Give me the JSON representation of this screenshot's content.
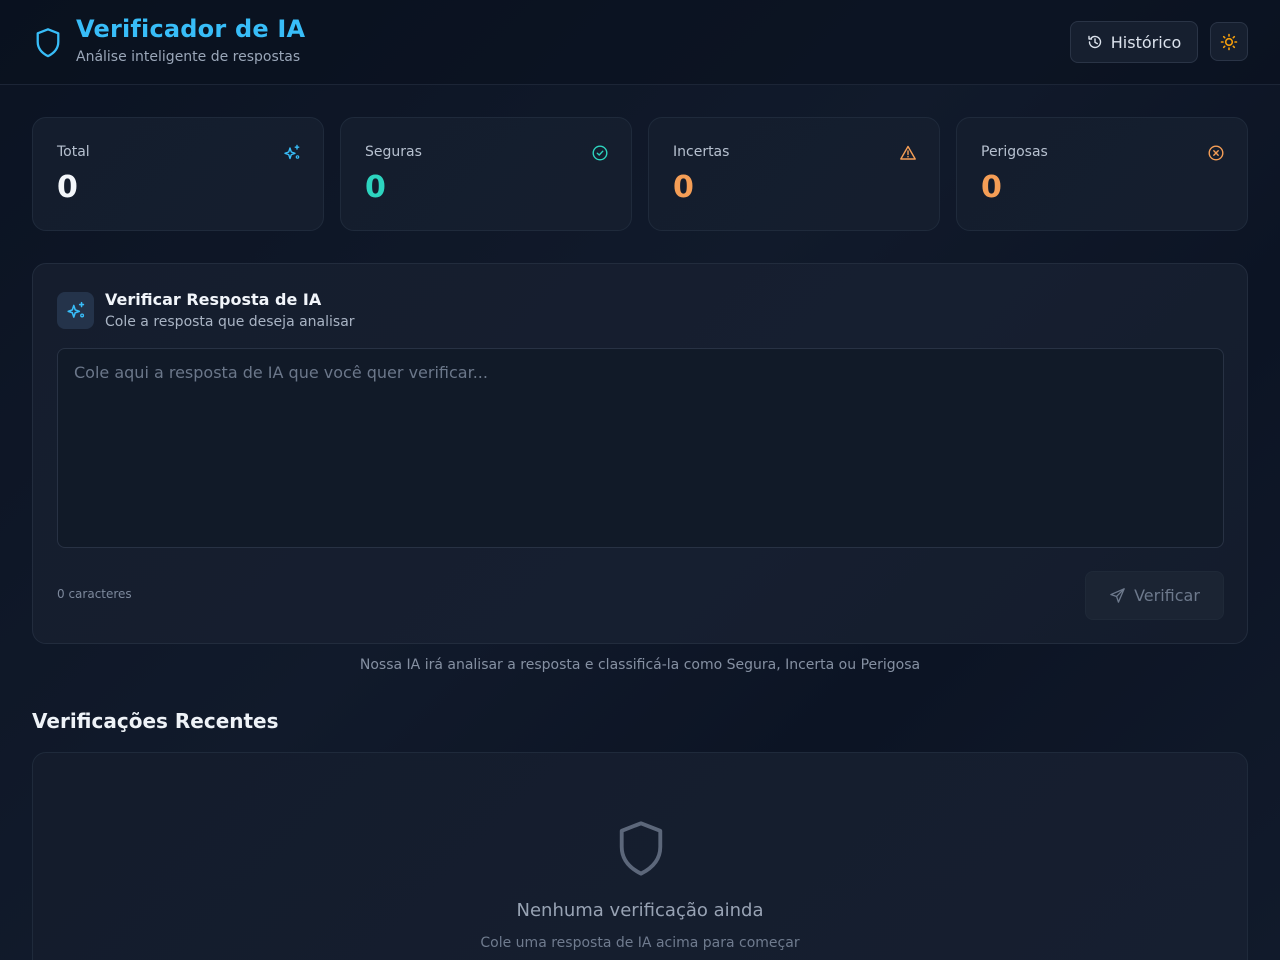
{
  "header": {
    "title": "Verificador de IA",
    "subtitle": "Análise inteligente de respostas",
    "history_label": "Histórico",
    "logo_icon": "shield-icon",
    "theme_icon": "sun-icon"
  },
  "stats": [
    {
      "label": "Total",
      "value": "0",
      "icon": "sparkles-icon",
      "color": "#f3f6fa",
      "icon_color": "#38bdf8"
    },
    {
      "label": "Seguras",
      "value": "0",
      "icon": "check-circle-icon",
      "color": "#2dd4bf",
      "icon_color": "#2dd4bf"
    },
    {
      "label": "Incertas",
      "value": "0",
      "icon": "warning-icon",
      "color": "#f59e56",
      "icon_color": "#f59e56"
    },
    {
      "label": "Perigosas",
      "value": "0",
      "icon": "x-circle-icon",
      "color": "#f59e56",
      "icon_color": "#f59e56"
    }
  ],
  "verify": {
    "title": "Verificar Resposta de IA",
    "subtitle": "Cole a resposta que deseja analisar",
    "placeholder": "Cole aqui a resposta de IA que você quer verificar...",
    "char_count": "0 caracteres",
    "button_label": "Verificar",
    "hint": "Nossa IA irá analisar a resposta e classificá-la como Segura, Incerta ou Perigosa"
  },
  "recent": {
    "title": "Verificações Recentes",
    "empty_title": "Nenhuma verificação ainda",
    "empty_subtitle": "Cole uma resposta de IA acima para começar"
  },
  "colors": {
    "accent": "#38bdf8",
    "safe": "#2dd4bf",
    "warning": "#f59e56"
  }
}
